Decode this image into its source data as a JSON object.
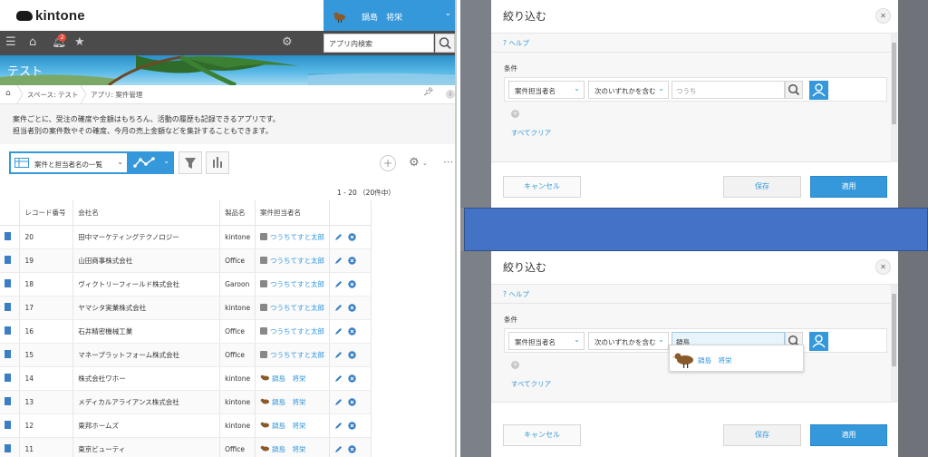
{
  "app": {
    "logo_text": "kintone"
  },
  "user": {
    "name": "鍋島　将栄"
  },
  "notifications": {
    "count": "2"
  },
  "app_search": {
    "placeholder": "アプリ内検索"
  },
  "banner": {
    "title": "テスト"
  },
  "breadcrumb": {
    "space": "スペース: テスト",
    "app": "アプリ: 案件管理"
  },
  "description": {
    "line1": "案件ごとに、受注の確度や金額はもちろん、活動の履歴も記録できるアプリです。",
    "line2": "担当者別の案件数やその確度、今月の売上金額などを集計することもできます。"
  },
  "view": {
    "selected": "案件と担当者名の一覧"
  },
  "pagination": {
    "text": "1 - 20 （20件中）"
  },
  "table": {
    "headers": [
      "レコード番号",
      "会社名",
      "製品名",
      "案件担当者名"
    ],
    "rows": [
      {
        "id": "20",
        "company": "田中マーケティングテクノロジー",
        "product": "kintone",
        "person": "つうちてすと太郎",
        "icon": "person-icon"
      },
      {
        "id": "19",
        "company": "山田商事株式会社",
        "product": "Office",
        "person": "つうちてすと太郎",
        "icon": "person-icon"
      },
      {
        "id": "18",
        "company": "ヴィクトリーフィールド株式会社",
        "product": "Garoon",
        "person": "つうちてすと太郎",
        "icon": "person-icon"
      },
      {
        "id": "17",
        "company": "ヤマシタ実業株式会社",
        "product": "kintone",
        "person": "つうちてすと太郎",
        "icon": "person-icon"
      },
      {
        "id": "16",
        "company": "石井精密機械工業",
        "product": "Office",
        "person": "つうちてすと太郎",
        "icon": "person-icon"
      },
      {
        "id": "15",
        "company": "マネープラットフォーム株式会社",
        "product": "Office",
        "person": "つうちてすと太郎",
        "icon": "person-icon"
      },
      {
        "id": "14",
        "company": "株式会社ワホー",
        "product": "kintone",
        "person": "鍋島　将栄",
        "icon": "bird-icon"
      },
      {
        "id": "13",
        "company": "メディカルアライアンス株式会社",
        "product": "kintone",
        "person": "鍋島　将栄",
        "icon": "bird-icon"
      },
      {
        "id": "12",
        "company": "東邦ホームズ",
        "product": "kintone",
        "person": "鍋島　将栄",
        "icon": "bird-icon"
      },
      {
        "id": "11",
        "company": "東京ビューティ",
        "product": "Office",
        "person": "鍋島　将栄",
        "icon": "bird-icon"
      }
    ]
  },
  "dialog_top": {
    "title": "絞り込む",
    "help": "ヘルプ",
    "condition_label": "条件",
    "field": "案件担当者名",
    "operator": "次のいずれかを含む",
    "value": "つうち",
    "clear_all": "すべてクリア",
    "cancel": "キャンセル",
    "save": "保存",
    "apply": "適用"
  },
  "dialog_bottom": {
    "title": "絞り込む",
    "help": "ヘルプ",
    "condition_label": "条件",
    "field": "案件担当者名",
    "operator": "次のいずれかを含む",
    "value": "鍋島",
    "suggestion": "鍋島　将栄",
    "clear_all": "すべてクリア",
    "cancel": "キャンセル",
    "save": "保存",
    "apply": "適用"
  },
  "colors": {
    "accent": "#3498db",
    "navbar": "#4b4b4b",
    "separator": "#4472c4"
  }
}
